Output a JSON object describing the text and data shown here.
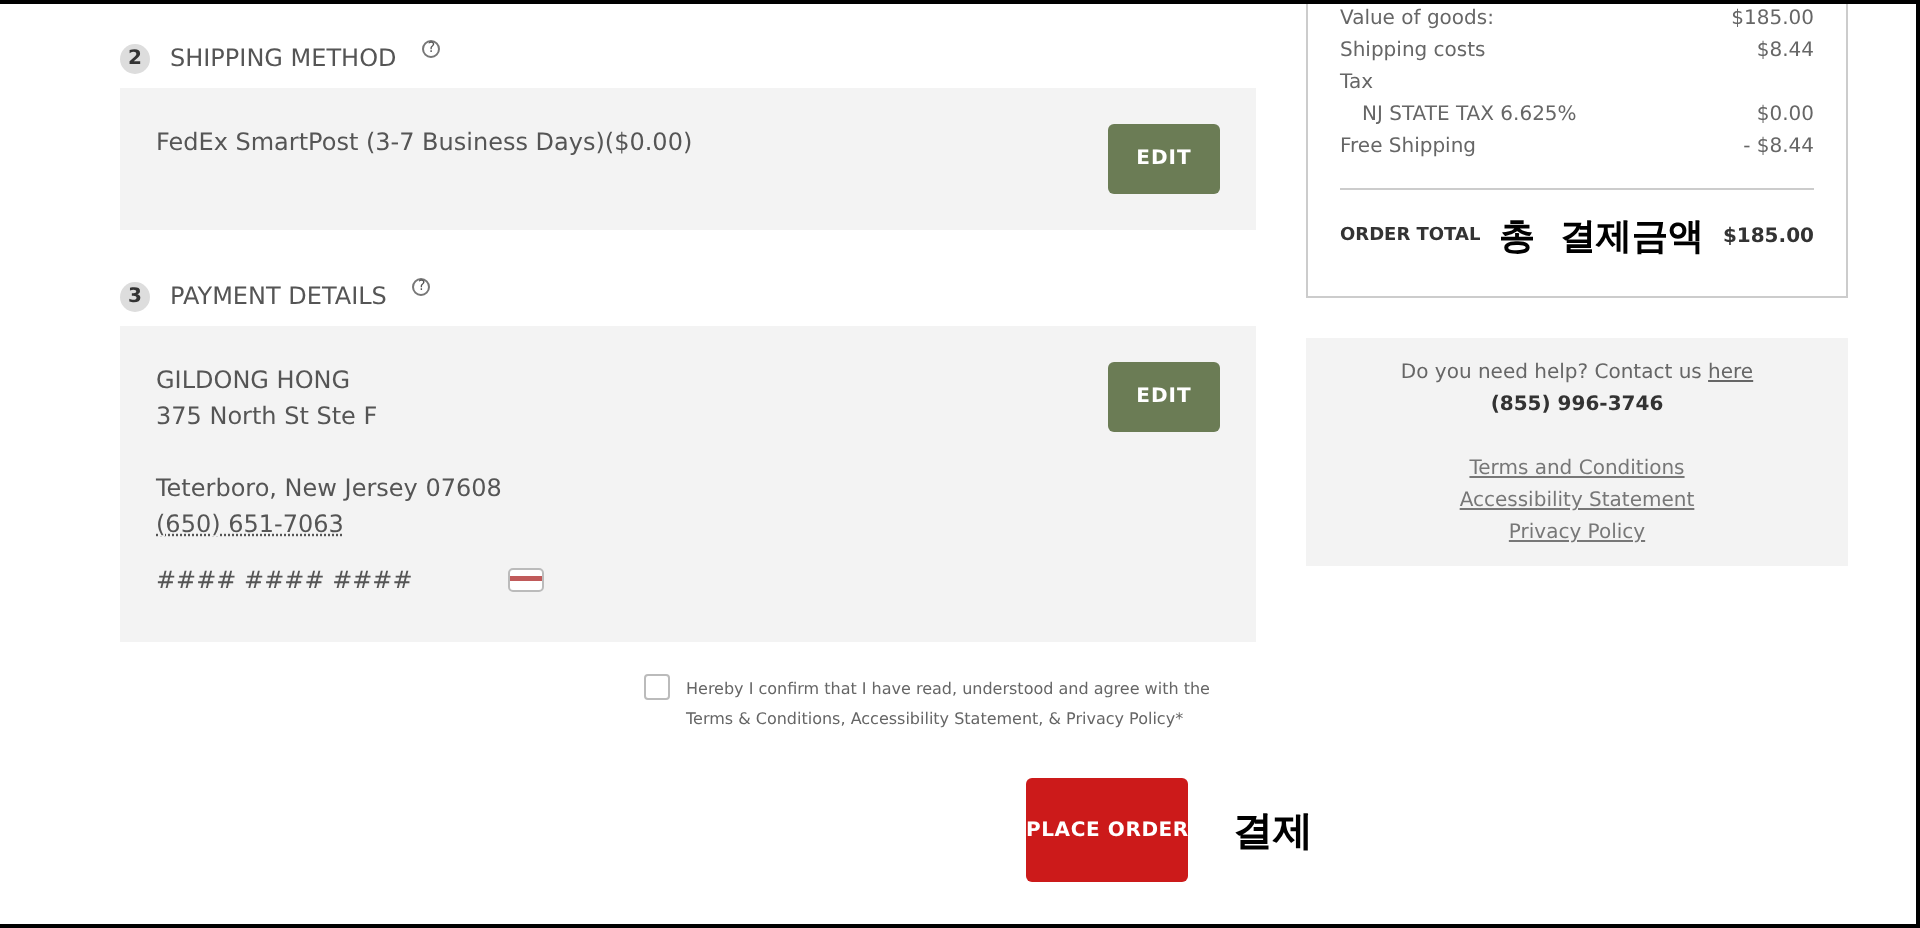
{
  "shipping_section": {
    "number": "2",
    "title": "SHIPPING METHOD",
    "help_icon": "?",
    "method": "FedEx SmartPost (3-7 Business Days)($0.00)",
    "edit_button": "EDIT"
  },
  "payment_section": {
    "number": "3",
    "title": "PAYMENT DETAILS",
    "help_icon": "?",
    "name": "GILDONG HONG",
    "address_line": "375 North St Ste F",
    "city_line": "Teterboro, New Jersey 07608",
    "phone": "(650) 651-7063",
    "card_number": "#### #### ####",
    "edit_button": "EDIT"
  },
  "agreement": {
    "checked": false,
    "text": "Hereby I confirm that I have read, understood and agree with the Terms & Conditions, Accessibility Statement, & Privacy Policy*"
  },
  "place_order_button": "PLACE ORDER",
  "place_order_annotation": "결제",
  "summary": {
    "lines": [
      {
        "label": "Value of goods:",
        "value": "$185.00"
      },
      {
        "label": "Shipping costs",
        "value": "$8.44"
      },
      {
        "label": "Tax",
        "children": [
          {
            "label": "NJ STATE TAX 6.625%",
            "value": "$0.00"
          }
        ]
      },
      {
        "label": "Free Shipping",
        "value": "- $8.44"
      }
    ],
    "total_label": "ORDER TOTAL",
    "total_annotation": "총  결제금액",
    "total_value": "$185.00"
  },
  "help": {
    "text": "Do you need help? Contact us",
    "link": "here",
    "phone": "(855) 996-3746",
    "links": [
      "Terms and Conditions",
      "Accessibility Statement",
      "Privacy Policy"
    ]
  }
}
